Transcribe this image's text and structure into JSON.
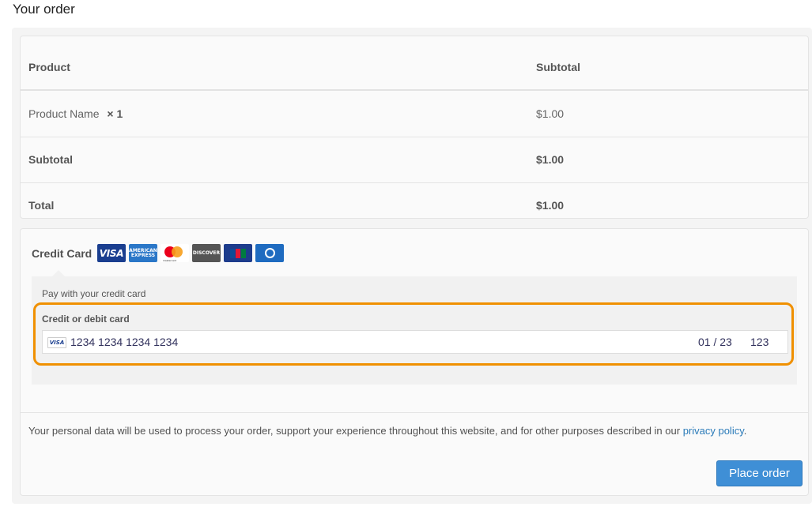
{
  "page": {
    "heading": "Your order"
  },
  "order_table": {
    "headers": {
      "product": "Product",
      "subtotal": "Subtotal"
    },
    "item": {
      "name": "Product Name",
      "qty": "× 1",
      "price": "$1.00"
    },
    "subtotal": {
      "label": "Subtotal",
      "value": "$1.00"
    },
    "total": {
      "label": "Total",
      "value": "$1.00"
    }
  },
  "payment": {
    "method_label": "Credit Card",
    "card_icons": [
      "visa-icon",
      "amex-icon",
      "mastercard-icon",
      "discover-icon",
      "jcb-icon",
      "diners-icon"
    ],
    "description": "Pay with your credit card",
    "card_field_label": "Credit or debit card",
    "card_number": "1234 1234 1234 1234",
    "expiry": "01 / 23",
    "cvc": "123",
    "card_brand": "VISA",
    "card_logo_text": {
      "visa": "VISA",
      "amex": "AMERICAN EXPRESS",
      "mastercard": "mastercard",
      "discover": "DISCOVER",
      "jcb": "JCB"
    }
  },
  "privacy": {
    "text": "Your personal data will be used to process your order, support your experience throughout this website, and for other purposes described in our ",
    "link_text": "privacy policy",
    "suffix": "."
  },
  "place_order_label": "Place order",
  "colors": {
    "accent": "#3f8fd6",
    "highlight": "#f09000",
    "link": "#2b7bb9"
  }
}
